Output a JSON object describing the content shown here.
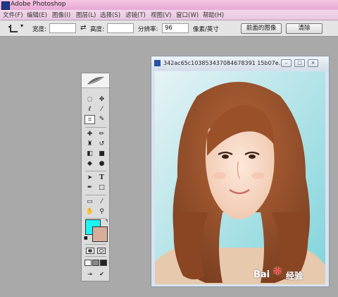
{
  "app": {
    "title": "Adobe Photoshop"
  },
  "menu": [
    "文件(F)",
    "编辑(E)",
    "图像(I)",
    "图层(L)",
    "选择(S)",
    "滤镜(T)",
    "视图(V)",
    "窗口(W)",
    "帮助(H)"
  ],
  "options": {
    "width_label": "宽度:",
    "width_value": "",
    "height_label": "高度:",
    "height_value": "",
    "resolution_label": "分辨率:",
    "resolution_value": "96",
    "unit": "像素/英寸",
    "front_image_button": "前面的图像",
    "clear_button": "清除"
  },
  "document": {
    "title": "342ac65c103853437084678391 15b07e..."
  },
  "toolbox": {
    "foreground_color": "#1ff4f4",
    "background_color": "#d8ad9c"
  },
  "watermark": {
    "brand": "Bai",
    "product": "经验"
  },
  "icons": [
    "crop-icon",
    "swap-icon",
    "minimize-icon",
    "maximize-icon",
    "close-icon",
    "feather-icon",
    "marquee-icon",
    "move-icon",
    "lasso-icon",
    "magic-wand-icon",
    "crop-tool-icon",
    "slice-icon",
    "healing-icon",
    "brush-icon",
    "stamp-icon",
    "history-brush-icon",
    "eraser-icon",
    "gradient-icon",
    "blur-icon",
    "dodge-icon",
    "path-select-icon",
    "type-icon",
    "pen-icon",
    "shape-icon",
    "notes-icon",
    "eyedropper-icon",
    "hand-icon",
    "zoom-icon"
  ]
}
